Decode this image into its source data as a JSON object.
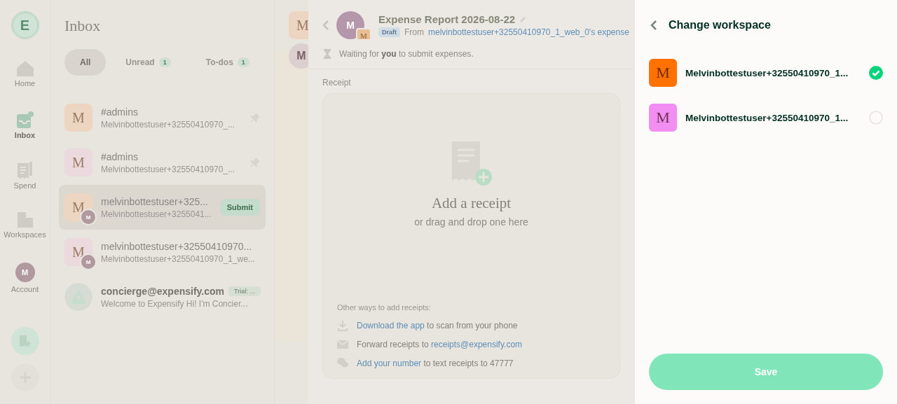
{
  "nav": {
    "logo_letter": "E",
    "items": [
      {
        "kind": "home",
        "label": "Home",
        "selected": false
      },
      {
        "kind": "inbox",
        "label": "Inbox",
        "selected": true
      },
      {
        "kind": "spend",
        "label": "Spend",
        "selected": false
      },
      {
        "kind": "workspaces",
        "label": "Workspaces",
        "selected": false
      },
      {
        "kind": "account",
        "label": "Account",
        "avatar": "M",
        "selected": false
      }
    ]
  },
  "inbox": {
    "title": "Inbox",
    "tabs": [
      {
        "label": "All",
        "selected": true
      },
      {
        "label": "Unread",
        "count": "1",
        "selected": false
      },
      {
        "label": "To-dos",
        "count": "1",
        "selected": false
      }
    ],
    "chats": [
      {
        "kind": "room",
        "avatar": "M",
        "color": "#ecd6c2",
        "title": "#admins",
        "preview": "Melvinbottestuser+32550410970_...",
        "pinned": true,
        "selected": false
      },
      {
        "kind": "room",
        "avatar": "M",
        "color": "#ecd9dd",
        "title": "#admins",
        "preview": "Melvinbottestuser+32550410970_...",
        "pinned": true,
        "selected": false
      },
      {
        "kind": "report",
        "avatar": "M",
        "color": "#ecd6c2",
        "sub_avatar": "M",
        "title": "melvinbottestuser+325...",
        "preview": "Melvinbottestuser+3255041...",
        "button": "Submit",
        "selected": true
      },
      {
        "kind": "report",
        "avatar": "M",
        "color": "#ecd9dd",
        "sub_avatar": "M",
        "title": "melvinbottestuser+32550410970...",
        "preview": "Melvinbottestuser+32550410970_1_we...",
        "selected": false
      },
      {
        "kind": "concierge",
        "color": "#d6dcd4",
        "title": "concierge@expensify.com",
        "badge": "Trial: ...",
        "preview": "Welcome to Expensify Hi! I'm Concier...",
        "selected": false
      }
    ]
  },
  "strip": {
    "avatars": [
      {
        "kind": "square",
        "letter": "M",
        "color": "#ecd6c2"
      },
      {
        "kind": "round",
        "letter": "M",
        "color": "#dccfcf"
      }
    ]
  },
  "report": {
    "title": "Expense Report 2026-08-22",
    "avatar": "M",
    "sub_avatar": "M",
    "status": "Draft",
    "from_label": "From",
    "from_link": "melvinbottestuser+32550410970_1_web_0's expense",
    "waiting": "Waiting for **you** to submit expenses.",
    "receipt_label": "Receipt",
    "drop_title": "Add a receipt",
    "drop_subtitle": "or drag and drop one here",
    "other_title": "Other ways to add receipts:",
    "ways": [
      {
        "kind": "download",
        "parts": [
          {
            "kind": "link",
            "text": "Download the app"
          },
          {
            "kind": "text",
            "text": " to scan from your phone"
          }
        ]
      },
      {
        "kind": "mail",
        "parts": [
          {
            "kind": "text",
            "text": "Forward receipts to "
          },
          {
            "kind": "link",
            "text": "receipts@expensify.com"
          }
        ]
      },
      {
        "kind": "chat",
        "parts": [
          {
            "kind": "link",
            "text": "Add your number"
          },
          {
            "kind": "text",
            "text": " to text receipts to 47777"
          }
        ]
      }
    ]
  },
  "panel": {
    "title": "Change workspace",
    "workspaces": [
      {
        "letter": "M",
        "color": "#ff7101",
        "name": "Melvinbottestuser+32550410970_1...",
        "selected": true
      },
      {
        "letter": "M",
        "color": "#f28df2",
        "name": "Melvinbottestuser+32550410970_1...",
        "selected": false
      }
    ],
    "save": {
      "label": "Save",
      "disabled": true
    }
  }
}
